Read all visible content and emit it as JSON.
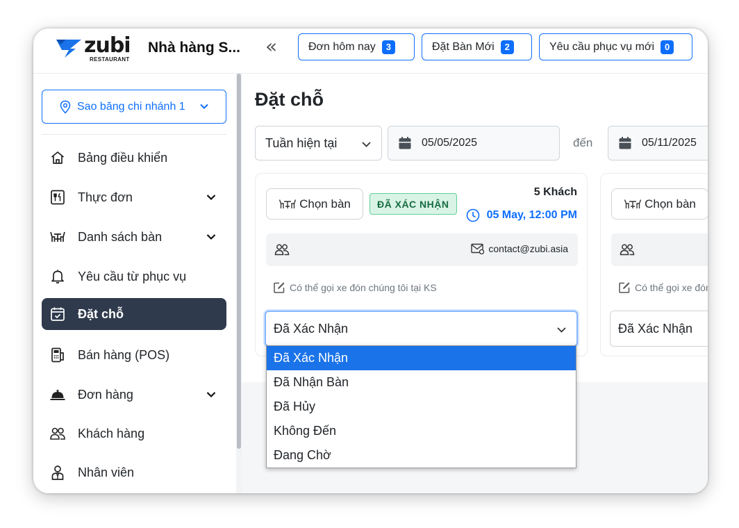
{
  "header": {
    "logo_text": "zubi",
    "logo_subtext": "RESTAURANT",
    "restaurant_name": "Nhà hàng S...",
    "buttons": [
      {
        "label": "Đơn hôm nay",
        "count": "3"
      },
      {
        "label": "Đặt Bàn Mới",
        "count": "2"
      },
      {
        "label": "Yêu cầu phục vụ mới",
        "count": "0"
      }
    ]
  },
  "sidebar": {
    "branch": "Sao băng chi nhánh 1",
    "items": [
      {
        "label": "Bảng điều khiển",
        "icon": "home-icon"
      },
      {
        "label": "Thực đơn",
        "icon": "menu-book-icon"
      },
      {
        "label": "Danh sách bàn",
        "icon": "table-icon"
      },
      {
        "label": "Yêu cầu từ phục vụ",
        "icon": "bell-icon"
      },
      {
        "label": "Đặt chỗ",
        "icon": "calendar-check-icon"
      },
      {
        "label": "Bán hàng (POS)",
        "icon": "pos-terminal-icon"
      },
      {
        "label": "Đơn hàng",
        "icon": "cloche-icon"
      },
      {
        "label": "Khách hàng",
        "icon": "users-icon"
      },
      {
        "label": "Nhân viên",
        "icon": "staff-icon"
      }
    ]
  },
  "main": {
    "title": "Đặt chỗ",
    "range_select": "Tuần hiện tại",
    "date_from": "05/05/2025",
    "to_label": "đến",
    "date_to": "05/11/2025",
    "cards": [
      {
        "select_table_label": "Chọn bàn",
        "status_badge": "ĐÃ XÁC NHẬN",
        "guests": "5 Khách",
        "datetime": "05 May, 12:00 PM",
        "email": "contact@zubi.asia",
        "note": "Có thể gọi xe đón chúng tôi tại KS",
        "status_value": "Đã Xác Nhận"
      },
      {
        "select_table_label": "Chọn bàn",
        "note": "Có thể gọi xe đón",
        "status_value": "Đã Xác Nhận"
      }
    ],
    "status_options": [
      "Đã Xác Nhận",
      "Đã Nhận Bàn",
      "Đã Hủy",
      "Không Đến",
      "Đang Chờ"
    ]
  },
  "colors": {
    "accent": "#0d6efd",
    "sidebar_active": "#2f3a4c",
    "badge_success_bg": "#d9f4e6",
    "badge_success_text": "#176c40",
    "option_highlight": "#1a73e8"
  }
}
